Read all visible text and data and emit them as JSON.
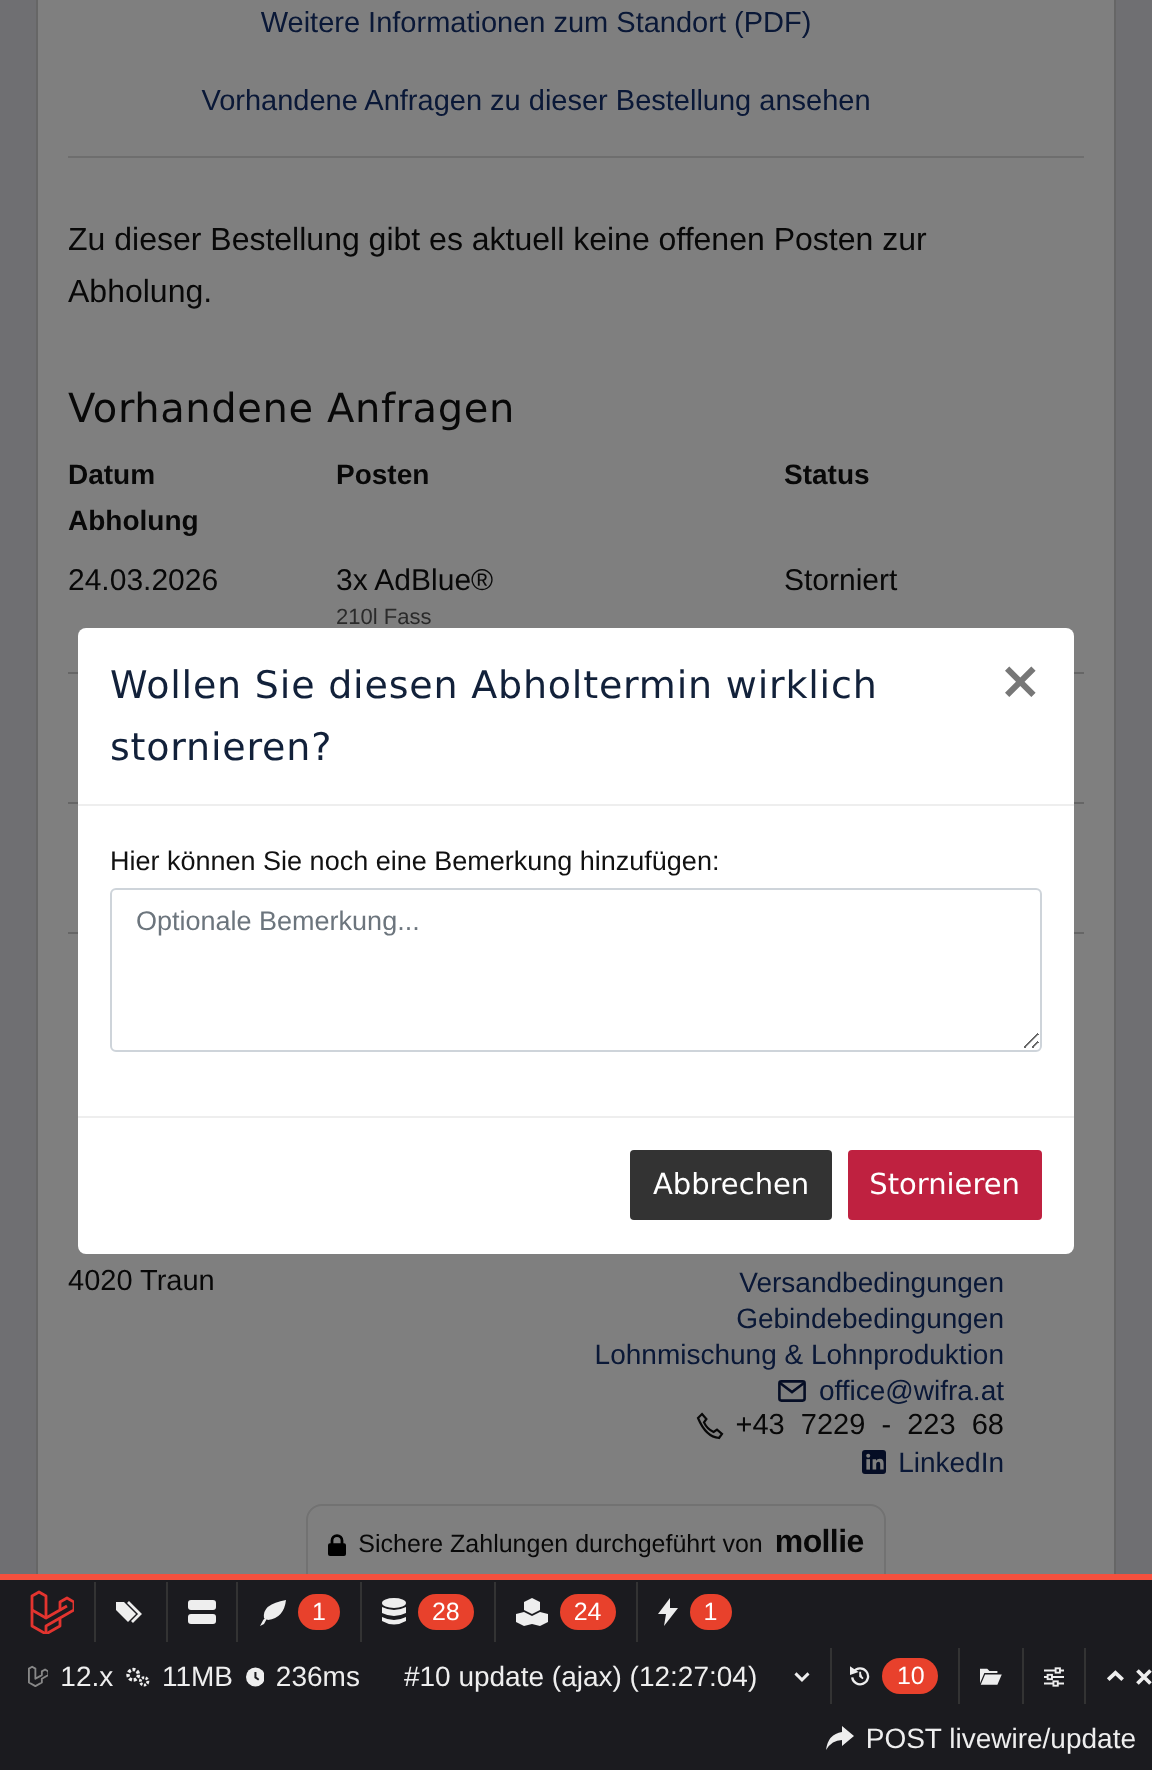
{
  "links": [
    "Weitere Informationen zum Standort (PDF)",
    "Vorhandene Anfragen zu dieser Bestellung ansehen"
  ],
  "notice": "Zu dieser Bestellung gibt es aktuell keine offenen Posten zur Abholung.",
  "requests": {
    "title": "Vorhandene Anfragen",
    "columns": [
      "Datum Abholung",
      "Posten",
      "Status"
    ],
    "rows": [
      {
        "date": "24.03.2026",
        "item": "3x AdBlue®",
        "detail": "210l Fass",
        "status": "Storniert"
      }
    ]
  },
  "footer": {
    "city": "4020 Traun",
    "links": [
      "Versandbedingungen",
      "Gebindebedingungen",
      "Lohnmischung & Lohnproduktion"
    ],
    "email": "office@wifra.at",
    "phone": "+43  7229  -  223  68",
    "linkedin": "LinkedIn",
    "payment": {
      "text": "Sichere Zahlungen durchgeführt von",
      "brand": "mollie"
    }
  },
  "modal": {
    "title": "Wollen Sie diesen Abholtermin wirklich stornieren?",
    "close": "×",
    "label": "Hier können Sie noch eine Bemerkung hinzufügen:",
    "placeholder": "Optionale Bemerkung...",
    "buttons": [
      {
        "label": "Abbrechen",
        "kind": "secondary"
      },
      {
        "label": "Stornieren",
        "kind": "danger"
      }
    ]
  },
  "debugbar": {
    "tabs": [
      {
        "kind": "logo"
      },
      {
        "kind": "tags"
      },
      {
        "kind": "server"
      },
      {
        "kind": "leaf",
        "count": "1"
      },
      {
        "kind": "database",
        "count": "28"
      },
      {
        "kind": "cubes",
        "count": "24"
      },
      {
        "kind": "bolt",
        "count": "1"
      }
    ],
    "version": "12.x",
    "memory": "11MB",
    "time": "236ms",
    "request": "#10 update (ajax) (12:27:04)",
    "history_count": "10",
    "route": "POST livewire/update"
  }
}
